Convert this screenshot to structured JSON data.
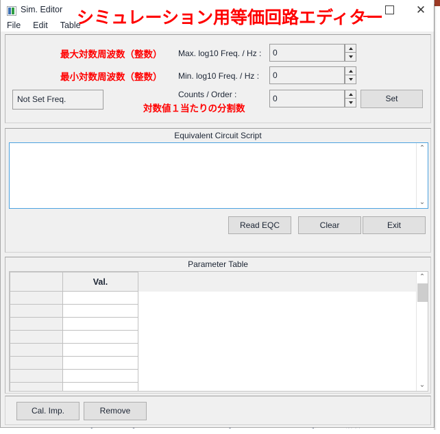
{
  "window": {
    "app_icon": "app-icon",
    "title": "Sim. Editor",
    "overlay_title": "シミュレーション用等価回路エディター",
    "minimize_label": "minimize-icon",
    "maximize_label": "maximize-icon",
    "close_label": "✕"
  },
  "menu": {
    "items": [
      {
        "label": "File"
      },
      {
        "label": "Edit"
      },
      {
        "label": "Table"
      }
    ]
  },
  "frequency": {
    "max_annotation": "最大対数周波数（整数）",
    "max_label": "Max. log10 Freq. / Hz :",
    "max_value": "0",
    "min_annotation": "最小対数周波数（整数）",
    "min_label": "Min. log10 Freq. / Hz :",
    "min_value": "0",
    "counts_label": "Counts / Order :",
    "counts_annotation": "対数値１当たりの分割数",
    "counts_value": "0",
    "status_text": "Not Set Freq.",
    "set_button": "Set",
    "spin_up": "▲",
    "spin_down": "▼"
  },
  "script": {
    "caption": "Equivalent Circuit Script",
    "value": "",
    "placeholder": "",
    "scroll_up": "⌃",
    "scroll_down": "⌄",
    "buttons": [
      {
        "label": "Read EQC"
      },
      {
        "label": "Clear"
      },
      {
        "label": "Exit"
      }
    ]
  },
  "parameter_table": {
    "caption": "Parameter Table",
    "columns": [
      "",
      "Val."
    ],
    "rows": [
      [
        "",
        ""
      ],
      [
        "",
        ""
      ],
      [
        "",
        ""
      ],
      [
        "",
        ""
      ],
      [
        "",
        ""
      ],
      [
        "",
        ""
      ],
      [
        "",
        ""
      ],
      [
        "",
        ""
      ],
      [
        "",
        ""
      ]
    ],
    "scroll_up": "⌃",
    "scroll_down": "⌄"
  },
  "bottom": {
    "cal_imp_button": "Cal. Imp.",
    "remove_button": "Remove"
  },
  "background": {
    "bottom_text": "[ニューロン]ワークショップのイナセン[ソフト/サポートページ]／データ解析ソフト"
  },
  "colors": {
    "accent_red": "#ff0000",
    "focus_blue": "#4ba2e0",
    "panel_gray": "#f0f0f0",
    "bg_window": "#9c3a25"
  }
}
